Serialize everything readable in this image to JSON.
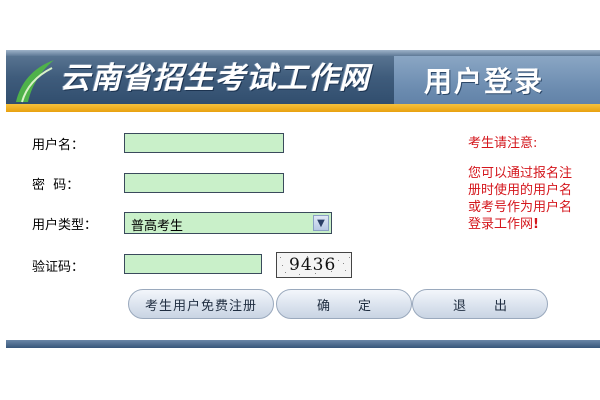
{
  "header": {
    "site_title": "云南省招生考试工作网",
    "login_title": "用户登录",
    "colors": {
      "banner": "#3f5c7c",
      "accent_bar": "#e8a110"
    },
    "logo_icon": "leaf-logo-icon"
  },
  "form": {
    "username_label": "用户名：",
    "username_value": "",
    "password_label": "密  码：",
    "password_value": "",
    "usertype_label": "用户类型：",
    "usertype_selected": "普高考生",
    "captcha_label": "验证码：",
    "captcha_value": "",
    "captcha_text": "9436",
    "field_color": "#c9f0c9"
  },
  "notice": {
    "title": "考生请注意:",
    "body": "您可以通过报名注册时使用的用户名或考号作为用户名登录工作网",
    "marker": "!",
    "color": "#d4161c"
  },
  "buttons": {
    "register": "考生用户免费注册",
    "confirm": "确定",
    "exit": "退出"
  }
}
